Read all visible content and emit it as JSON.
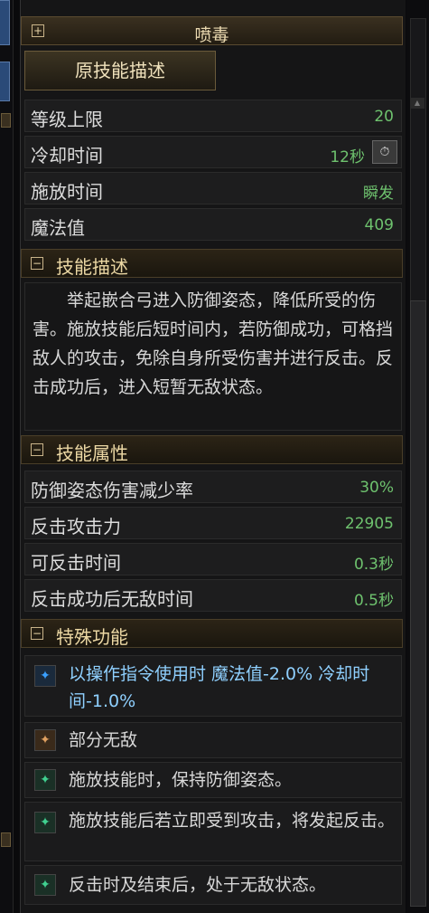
{
  "skill_name": "喷毒",
  "original_description_button": "原技能描述",
  "stats": [
    {
      "label": "等级上限",
      "value": "20"
    },
    {
      "label": "冷却时间",
      "value": "12秒"
    },
    {
      "label": "施放时间",
      "value": "瞬发"
    },
    {
      "label": "魔法值",
      "value": "409"
    }
  ],
  "sections": {
    "description": "技能描述",
    "attributes": "技能属性",
    "special": "特殊功能"
  },
  "description_text": "举起嵌合弓进入防御姿态，降低所受的伤害。施放技能后短时间内，若防御成功，可格挡敌人的攻击，免除自身所受伤害并进行反击。反击成功后，进入短暂无敌状态。",
  "attributes": [
    {
      "label": "防御姿态伤害减少率",
      "value": "30%"
    },
    {
      "label": "反击攻击力",
      "value": "22905"
    },
    {
      "label": "可反击时间",
      "value": "0.3秒"
    },
    {
      "label": "反击成功后无敌时间",
      "value": "0.5秒"
    }
  ],
  "special_features": [
    {
      "text": "以操作指令使用时 魔法值-2.0% 冷却时间-1.0%",
      "icon": "blue-sparkle-icon",
      "color": "#8fd0ff"
    },
    {
      "text": "部分无敌",
      "icon": "orange-sparkle-icon",
      "color": "#d8d8d8"
    },
    {
      "text": "施放技能时，保持防御姿态。",
      "icon": "green-sparkle-icon",
      "color": "#d8d8d8"
    },
    {
      "text": "施放技能后若立即受到攻击，将发起反击。",
      "icon": "green-sparkle-icon",
      "color": "#d8d8d8"
    },
    {
      "text": "反击时及结束后，处于无敌状态。",
      "icon": "green-sparkle-icon",
      "color": "#d8d8d8"
    }
  ],
  "colors": {
    "value_green": "#6ec26e",
    "section_title": "#ecd8a4",
    "special_blue": "#8fd0ff",
    "blue_icon": "#3aa0ff",
    "orange_icon": "#e0a060",
    "green_icon": "#40d090"
  }
}
